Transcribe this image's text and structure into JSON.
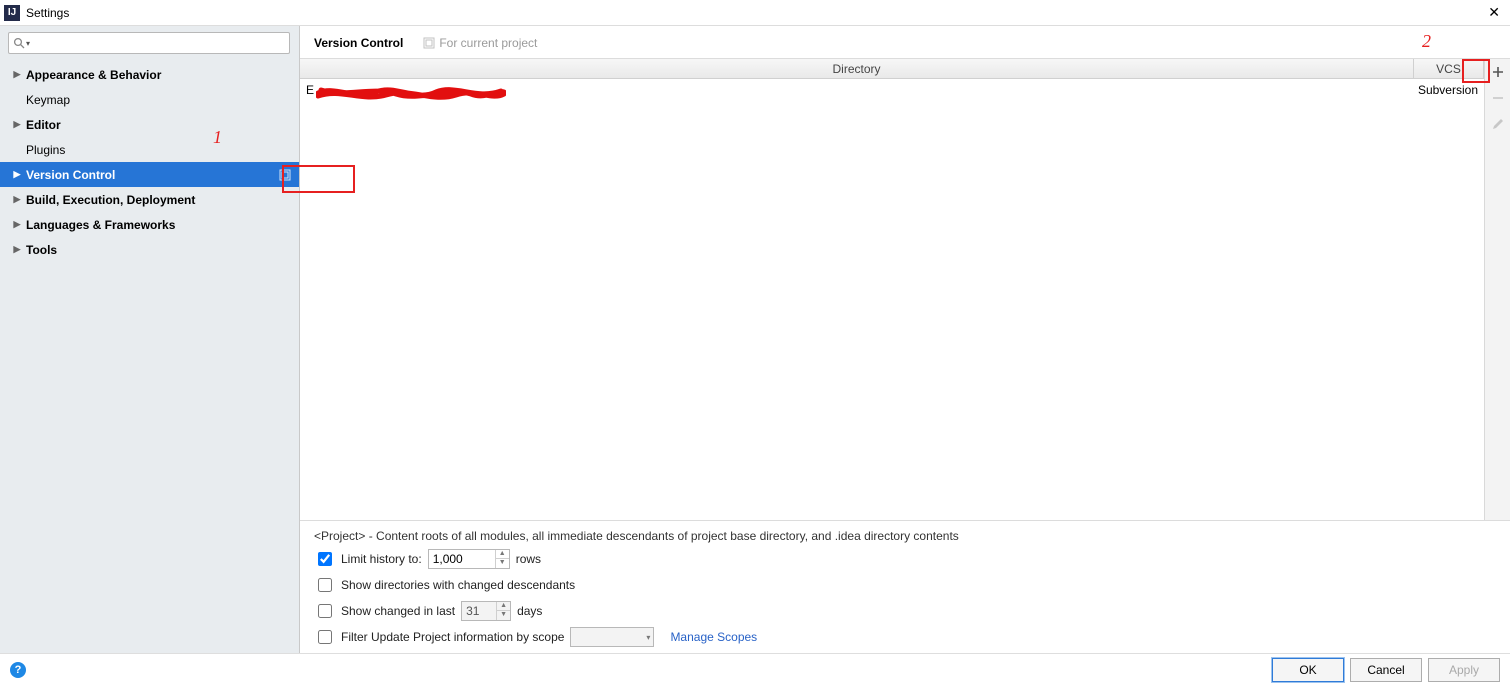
{
  "window": {
    "title": "Settings"
  },
  "search": {
    "placeholder": ""
  },
  "sidebar": {
    "items": [
      {
        "label": "Appearance & Behavior",
        "expandable": true,
        "child": false
      },
      {
        "label": "Keymap",
        "expandable": false,
        "child": true
      },
      {
        "label": "Editor",
        "expandable": true,
        "child": false
      },
      {
        "label": "Plugins",
        "expandable": false,
        "child": true
      },
      {
        "label": "Version Control",
        "expandable": true,
        "child": false,
        "selected": true,
        "project": true
      },
      {
        "label": "Build, Execution, Deployment",
        "expandable": true,
        "child": false
      },
      {
        "label": "Languages & Frameworks",
        "expandable": true,
        "child": false
      },
      {
        "label": "Tools",
        "expandable": true,
        "child": false
      }
    ]
  },
  "content": {
    "title": "Version Control",
    "note": "For current project",
    "columns": {
      "directory": "Directory",
      "vcs": "VCS"
    },
    "rows": [
      {
        "directory_prefix": "E",
        "vcs": "Subversion"
      }
    ],
    "hint": "<Project> - Content roots of all modules, all immediate descendants of project base directory, and .idea directory contents",
    "limit": {
      "checked": true,
      "label_pre": "Limit history to:",
      "value": "1,000",
      "label_post": "rows"
    },
    "show_dirs_changed": {
      "checked": false,
      "label": "Show directories with changed descendants"
    },
    "show_changed_last": {
      "checked": false,
      "label_pre": "Show changed in last",
      "value": "31",
      "label_post": "days"
    },
    "filter_scope": {
      "checked": false,
      "label": "Filter Update Project information by scope",
      "link": "Manage Scopes"
    }
  },
  "buttons": {
    "ok": "OK",
    "cancel": "Cancel",
    "apply": "Apply"
  },
  "annotations": {
    "one": "1",
    "two": "2"
  }
}
